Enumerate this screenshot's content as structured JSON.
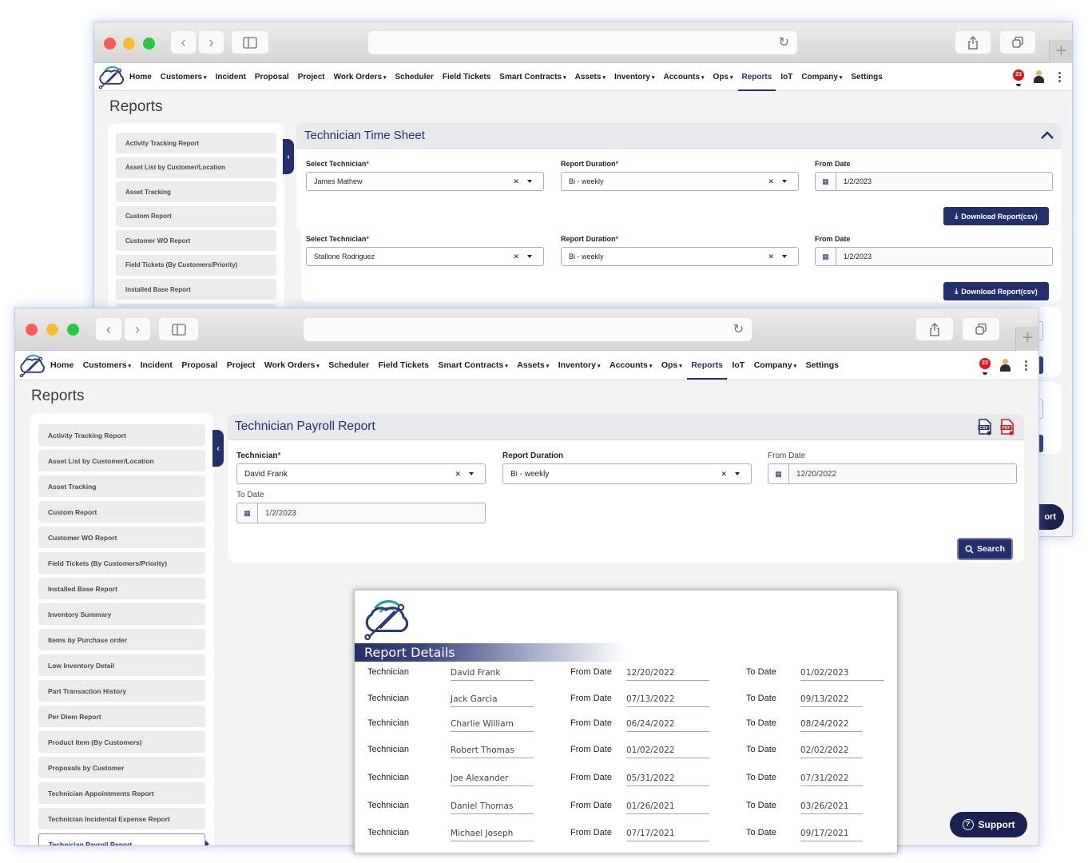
{
  "nav": {
    "items": [
      {
        "label": "Home",
        "dropdown": false
      },
      {
        "label": "Customers",
        "dropdown": true
      },
      {
        "label": "Incident",
        "dropdown": false
      },
      {
        "label": "Proposal",
        "dropdown": false
      },
      {
        "label": "Project",
        "dropdown": false
      },
      {
        "label": "Work Orders",
        "dropdown": true
      },
      {
        "label": "Scheduler",
        "dropdown": false
      },
      {
        "label": "Field Tickets",
        "dropdown": false
      },
      {
        "label": "Smart Contracts",
        "dropdown": true
      },
      {
        "label": "Assets",
        "dropdown": true
      },
      {
        "label": "Inventory",
        "dropdown": true
      },
      {
        "label": "Accounts",
        "dropdown": true
      },
      {
        "label": "Ops",
        "dropdown": true
      },
      {
        "label": "Reports",
        "dropdown": false,
        "active": true
      },
      {
        "label": "IoT",
        "dropdown": false
      },
      {
        "label": "Company",
        "dropdown": true
      },
      {
        "label": "Settings",
        "dropdown": false
      }
    ],
    "notification_count": "23",
    "chevron": "⌄",
    "kebab": "⋮"
  },
  "browser": {
    "back": "‹",
    "forward": "›",
    "reload": "↻",
    "new_tab": "+"
  },
  "page_title": "Reports",
  "back_window": {
    "sidebar": [
      "Activity Tracking Report",
      "Asset List by Customer/Location",
      "Asset Tracking",
      "Custom Report",
      "Customer WO Report",
      "Field Tickets (By Customers/Priority)",
      "Installed Base Report",
      ""
    ],
    "card_title": "Technician Time Sheet",
    "forms": [
      {
        "technician_label": "Select Technician",
        "technician_value": "James Mathew",
        "duration_label": "Report Duration",
        "duration_value": "Bi - weekly",
        "from_label": "From Date",
        "from_value": "1/2/2023",
        "download_label": "Download Report(csv)"
      },
      {
        "technician_label": "Select Technician",
        "technician_value": "Stallone Rodriguez",
        "duration_label": "Report Duration",
        "duration_value": "Bi - weekly",
        "from_label": "From Date",
        "from_value": "1/2/2023",
        "download_label": "Download Report(csv)"
      }
    ],
    "partial_button": "ort"
  },
  "front_window": {
    "sidebar": [
      "Activity Tracking Report",
      "Asset List by Customer/Location",
      "Asset Tracking",
      "Custom Report",
      "Customer WO Report",
      "Field Tickets (By Customers/Priority)",
      "Installed Base Report",
      "Inventory Summary",
      "Items by Purchase order",
      "Low Inventory Detail",
      "Part Transaction History",
      "Per Diem Report",
      "Product Item (By Customers)",
      "Proposals by Customer",
      "Technician Appointments Report",
      "Technician Incidental Expense Report",
      "Technician Payroll Report"
    ],
    "active_sidebar_item": "Technician Payroll Report",
    "card_title": "Technician Payroll Report",
    "export_icons": {
      "csv": "CSV",
      "pdf": "PDF"
    },
    "technician_label": "Technician",
    "technician_value": "David Frank",
    "duration_label": "Report Duration",
    "duration_value": "Bi - weekly",
    "from_label": "From Date",
    "from_value": "12/20/2022",
    "to_label": "To Date",
    "to_value": "1/2/2023",
    "search_label": "Search"
  },
  "report_details": {
    "title": "Report Details",
    "labels": {
      "technician": "Technician",
      "from": "From Date",
      "to": "To Date"
    },
    "rows": [
      {
        "technician": "David Frank",
        "from": "12/20/2022",
        "to": "01/02/2023"
      },
      {
        "technician": "Jack Garcia",
        "from": "07/13/2022",
        "to": "09/13/2022"
      },
      {
        "technician": "Charlie William",
        "from": "06/24/2022",
        "to": "08/24/2022"
      },
      {
        "technician": "Robert Thomas",
        "from": "01/02/2022",
        "to": "02/02/2022"
      },
      {
        "technician": "Joe Alexander",
        "from": "05/31/2022",
        "to": "07/31/2022"
      },
      {
        "technician": "Daniel Thomas",
        "from": "01/26/2021",
        "to": "03/26/2021"
      },
      {
        "technician": "Michael Joseph",
        "from": "07/17/2021",
        "to": "09/17/2021"
      }
    ]
  },
  "support_label": "Support",
  "colors": {
    "brand_navy": "#23306b",
    "support_navy": "#1a2150",
    "required_red": "#e0161c",
    "logo_teal": "#1fa38f"
  }
}
